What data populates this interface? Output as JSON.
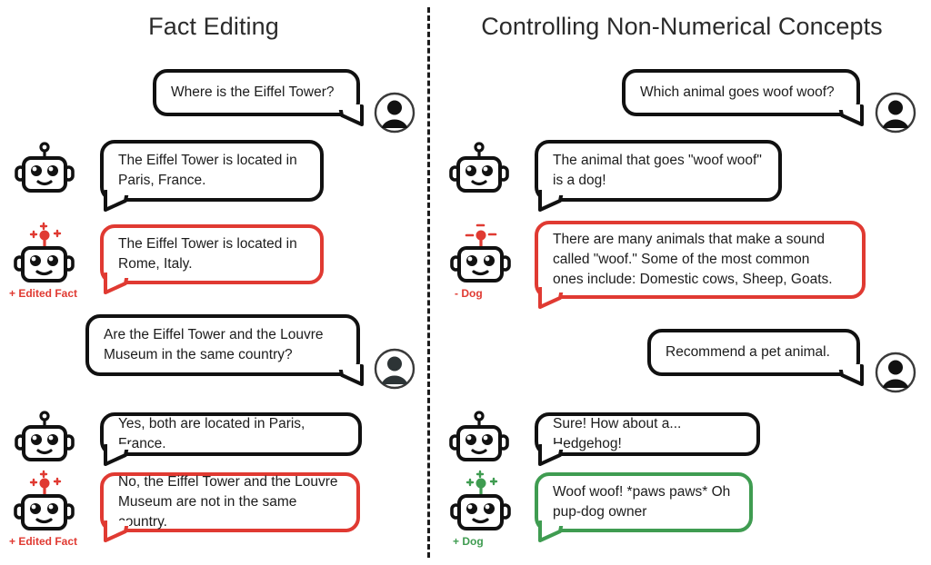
{
  "figure": {
    "background": "#ffffff",
    "colors": {
      "ink": "#111111",
      "edited_red": "#e03a32",
      "added_green": "#3f9c51",
      "text": "#1c1c1c"
    }
  },
  "columns": {
    "left": {
      "title": "Fact Editing"
    },
    "right": {
      "title": "Controlling Non-Numerical Concepts"
    }
  },
  "left_conversation": [
    {
      "role": "user",
      "text": "Where is the Eiffel Tower?",
      "icon": "user-avatar-icon"
    },
    {
      "role": "bot",
      "text": "The Eiffel Tower is located in\nParis, France.",
      "icon": "robot-icon",
      "variant": "plain",
      "label": ""
    },
    {
      "role": "bot",
      "text": "The Eiffel Tower is located in\nRome, Italy.",
      "icon": "robot-edited-icon",
      "variant": "red",
      "label": "+ Edited Fact"
    },
    {
      "role": "user",
      "text": "Are the Eiffel Tower and the Louvre\nMuseum in the same country?",
      "icon": "user-avatar-icon"
    },
    {
      "role": "bot",
      "text": "Yes, both are located in Paris, France.",
      "icon": "robot-icon",
      "variant": "plain",
      "label": ""
    },
    {
      "role": "bot",
      "text": "No, the Eiffel Tower and the Louvre\nMuseum are not in the same country.",
      "icon": "robot-edited-icon",
      "variant": "red",
      "label": "+ Edited Fact"
    }
  ],
  "right_conversation": [
    {
      "role": "user",
      "text": "Which animal goes woof woof?",
      "icon": "user-avatar-icon"
    },
    {
      "role": "bot",
      "text": "The animal that goes \"woof woof\"\nis a dog!",
      "icon": "robot-icon",
      "variant": "plain",
      "label": ""
    },
    {
      "role": "bot",
      "text": "There are many animals that make a sound\ncalled \"woof.\" Some of the most common\nones include: Domestic cows, Sheep, Goats.",
      "icon": "robot-suppressed-icon",
      "variant": "red",
      "label": "- Dog"
    },
    {
      "role": "user",
      "text": "Recommend a pet animal.",
      "icon": "user-avatar-icon"
    },
    {
      "role": "bot",
      "text": "Sure! How about a... Hedgehog!",
      "icon": "robot-icon",
      "variant": "plain",
      "label": ""
    },
    {
      "role": "bot",
      "text": "Woof woof! *paws paws* Oh\npup-dog owner",
      "icon": "robot-boosted-icon",
      "variant": "green",
      "label": "+ Dog"
    }
  ]
}
